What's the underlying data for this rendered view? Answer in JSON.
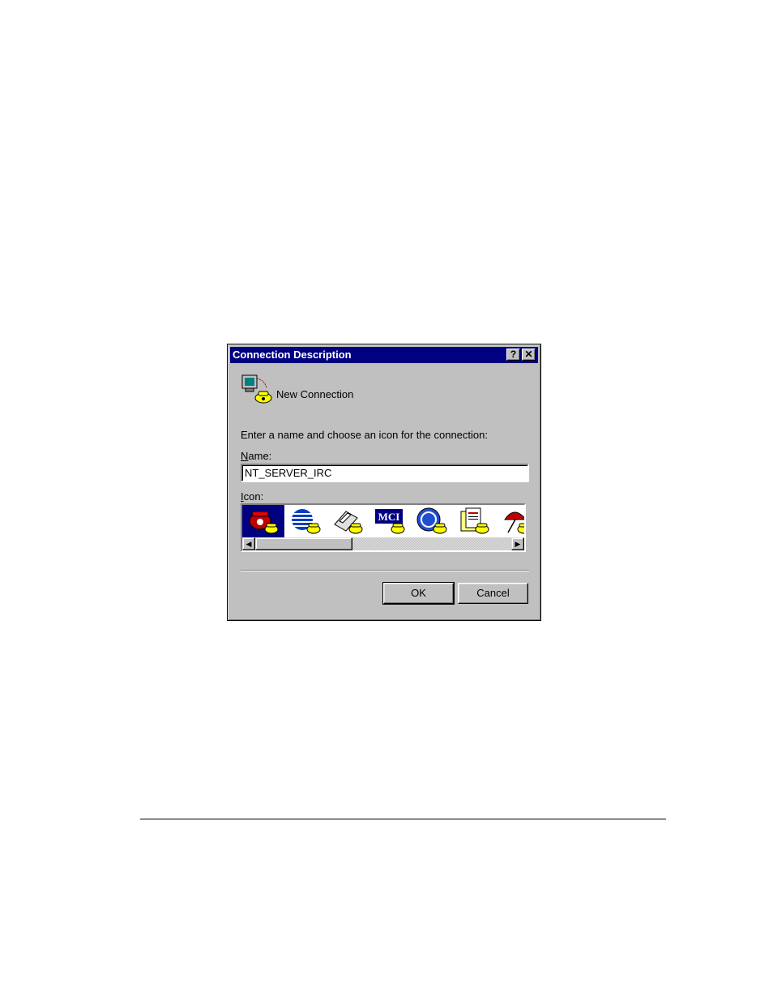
{
  "dialog": {
    "title": "Connection Description",
    "help_button": "?",
    "close_button": "✕",
    "connection_name": "New Connection",
    "instruction": "Enter a name and choose an icon for the connection:",
    "name_label_accel": "N",
    "name_label_rest": "ame:",
    "name_value": "NT_SERVER_IRC",
    "icon_label_accel": "I",
    "icon_label_rest": "con:",
    "icons": [
      "phone-icon",
      "att-globe-icon",
      "fax-icon",
      "mci-icon",
      "ge-globe-icon",
      "documents-icon",
      "umbrella-icon"
    ],
    "selected_icon_index": 0,
    "ok_label": "OK",
    "cancel_label": "Cancel"
  },
  "colors": {
    "titlebar": "#000080",
    "dialog_face": "#c0c0c0",
    "phone_yellow": "#ffff00"
  }
}
